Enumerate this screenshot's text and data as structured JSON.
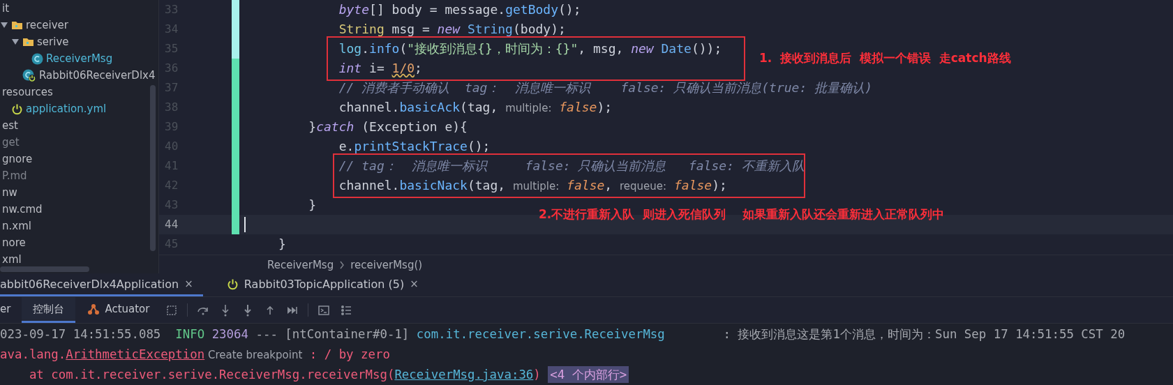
{
  "project_tree": [
    {
      "label": "it",
      "color": "#bcbec4",
      "children": [
        {
          "label": "receiver",
          "kind": "folder",
          "expanded": true,
          "color": "#bcbec4",
          "children": [
            {
              "label": "serive",
              "kind": "folder",
              "expanded": true,
              "color": "#bcbec4",
              "children": [
                {
                  "label": "ReceiverMsg",
                  "kind": "class",
                  "color": "#4fb8d8"
                }
              ]
            },
            {
              "label": "Rabbit06ReceiverDlx4",
              "kind": "boot-class",
              "color": "#bcbec4"
            }
          ]
        }
      ]
    },
    {
      "label": "resources",
      "color": "#bcbec4",
      "children": [
        {
          "label": "application.yml",
          "kind": "config",
          "color": "#4fb8d8"
        }
      ]
    },
    {
      "label": "est",
      "color": "#bcbec4"
    },
    {
      "label": "get",
      "color": "#7f838c"
    },
    {
      "label": "gnore",
      "color": "#bcbec4"
    },
    {
      "label": "P.md",
      "color": "#7f838c"
    },
    {
      "label": "nw",
      "color": "#bcbec4"
    },
    {
      "label": "nw.cmd",
      "color": "#bcbec4"
    },
    {
      "label": "n.xml",
      "color": "#bcbec4"
    },
    {
      "label": "nore",
      "color": "#bcbec4"
    },
    {
      "label": "xml",
      "color": "#bcbec4"
    }
  ],
  "editor": {
    "lines": [
      {
        "number": "33",
        "current": false,
        "tokens": [
          {
            "text": "        byte",
            "kind": "kw"
          },
          {
            "text": "[] body = message.",
            "kind": "plain"
          },
          {
            "text": "getBody",
            "kind": "fn"
          },
          {
            "text": "();",
            "kind": "plain"
          }
        ]
      },
      {
        "number": "34",
        "current": false,
        "tokens": [
          {
            "text": "        String",
            "kind": "type"
          },
          {
            "text": " msg = ",
            "kind": "plain"
          },
          {
            "text": "new ",
            "kind": "kw"
          },
          {
            "text": "String",
            "kind": "cls"
          },
          {
            "text": "(body);",
            "kind": "plain"
          }
        ]
      },
      {
        "number": "35",
        "current": false,
        "tokens": [
          {
            "text": "        log",
            "kind": "field"
          },
          {
            "text": ".",
            "kind": "plain"
          },
          {
            "text": "info",
            "kind": "fn"
          },
          {
            "text": "(",
            "kind": "plain"
          },
          {
            "text": "\"接收到消息{}，时间为：{}\"",
            "kind": "str"
          },
          {
            "text": ", msg, ",
            "kind": "plain"
          },
          {
            "text": "new ",
            "kind": "kw"
          },
          {
            "text": "Date",
            "kind": "cls"
          },
          {
            "text": "());",
            "kind": "plain"
          }
        ]
      },
      {
        "number": "36",
        "current": false,
        "tokens": [
          {
            "text": "        int",
            "kind": "kw"
          },
          {
            "text": " i= ",
            "kind": "plain"
          },
          {
            "text": "1/0",
            "kind": "num"
          },
          {
            "text": ";",
            "kind": "plain"
          }
        ]
      },
      {
        "number": "37",
        "current": false,
        "tokens": [
          {
            "text": "        // 消费者手动确认  tag：  消息唯一标识    false: 只确认当前消息(true: 批量确认)",
            "kind": "cmt"
          }
        ]
      },
      {
        "number": "38",
        "current": false,
        "tokens": [
          {
            "text": "        channel.",
            "kind": "plain"
          },
          {
            "text": "basicAck",
            "kind": "fn"
          },
          {
            "text": "(tag, ",
            "kind": "plain"
          },
          {
            "text": "multiple:",
            "kind": "hint"
          },
          {
            "text": " false",
            "kind": "bool"
          },
          {
            "text": ");",
            "kind": "plain"
          }
        ]
      },
      {
        "number": "39",
        "current": false,
        "tokens": [
          {
            "text": "    }",
            "kind": "plain"
          },
          {
            "text": "catch",
            "kind": "kw"
          },
          {
            "text": " (Exception e){",
            "kind": "plain"
          }
        ]
      },
      {
        "number": "40",
        "current": false,
        "tokens": [
          {
            "text": "        e.",
            "kind": "plain"
          },
          {
            "text": "printStackTrace",
            "kind": "fn"
          },
          {
            "text": "();",
            "kind": "plain"
          }
        ]
      },
      {
        "number": "41",
        "current": false,
        "tokens": [
          {
            "text": "        // tag：  消息唯一标识     false: 只确认当前消息   false: 不重新入队",
            "kind": "cmt"
          }
        ]
      },
      {
        "number": "42",
        "current": false,
        "tokens": [
          {
            "text": "        channel.",
            "kind": "plain"
          },
          {
            "text": "basicNack",
            "kind": "fn"
          },
          {
            "text": "(tag, ",
            "kind": "plain"
          },
          {
            "text": "multiple:",
            "kind": "hint"
          },
          {
            "text": " false",
            "kind": "bool"
          },
          {
            "text": ", ",
            "kind": "plain"
          },
          {
            "text": "requeue:",
            "kind": "hint"
          },
          {
            "text": " false",
            "kind": "bool"
          },
          {
            "text": ");",
            "kind": "plain"
          }
        ]
      },
      {
        "number": "43",
        "current": false,
        "tokens": [
          {
            "text": "    }",
            "kind": "plain"
          }
        ]
      },
      {
        "number": "44",
        "current": true
      },
      {
        "number": "45",
        "current": false,
        "tokens": [
          {
            "text": "}",
            "kind": "plain"
          }
        ]
      }
    ],
    "annotations": [
      {
        "label": "1.  接收到消息后  模拟一个错误  走catch路线"
      },
      {
        "label": "2.不进行重新入队  则进入死信队列    如果重新入队还会重新进入正常队列中"
      }
    ]
  },
  "breadcrumb": [
    "ReceiverMsg",
    "receiverMsg()"
  ],
  "run_tabs": [
    {
      "label": "abbit06ReceiverDlx4Application",
      "kind": "plain",
      "selected": true,
      "close": "×"
    },
    {
      "label": "Rabbit03TopicApplication (5)",
      "kind": "boot",
      "selected": false,
      "close": "×"
    }
  ],
  "tool_tabs": [
    {
      "label": "er",
      "kind": "plain",
      "selected": false
    },
    {
      "label": "控制台",
      "kind": "plain",
      "selected": true
    },
    {
      "label": "Actuator",
      "kind": "actuator",
      "selected": false
    }
  ],
  "console": [
    [
      {
        "text": "023-09-17 14:51:55.085  ",
        "kind": "dim"
      },
      {
        "text": "INFO ",
        "kind": "info"
      },
      {
        "text": "23064",
        "kind": "pid"
      },
      {
        "text": " --- [ntContainer#0-1] ",
        "kind": "dim"
      },
      {
        "text": "com.it.receiver.serive.ReceiverMsg",
        "kind": "logger"
      },
      {
        "text": "        : 接收到消息这是第1个消息，时间为：Sun Sep 17 14:51:55 CST 20",
        "kind": "dim"
      }
    ],
    [
      {
        "text": "ava.lang.",
        "kind": "err"
      },
      {
        "text": "ArithmeticException",
        "kind": "errlink"
      },
      {
        "text": " Create breakpoint",
        "kind": "hint"
      },
      {
        "text": " : / by zero",
        "kind": "err"
      }
    ],
    [
      {
        "text": "    at com.it.receiver.serive.ReceiverMsg.receiverMsg(",
        "kind": "err"
      },
      {
        "text": "ReceiverMsg.java:36",
        "kind": "link"
      },
      {
        "text": ") ",
        "kind": "err"
      },
      {
        "text": "<4 个内部行>",
        "kind": "fold"
      }
    ]
  ]
}
